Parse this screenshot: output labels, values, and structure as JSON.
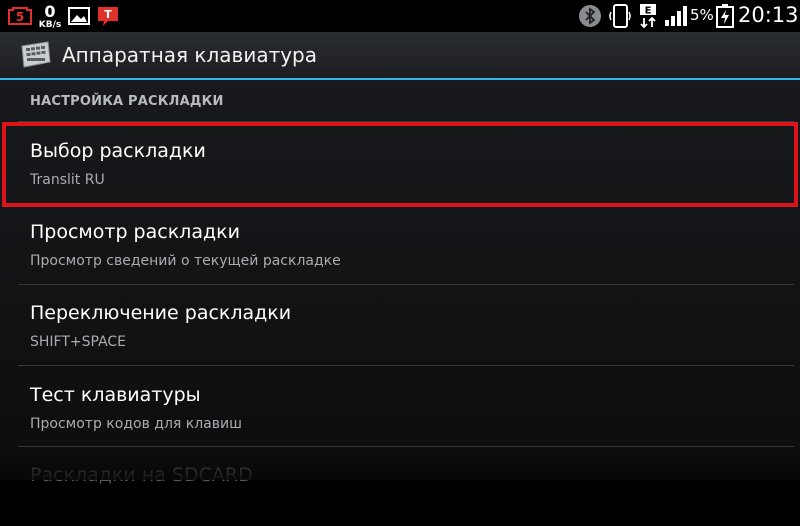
{
  "status_bar": {
    "notification_5": "5",
    "net_speed_value": "0",
    "net_speed_unit": "KB/s",
    "t_badge": "T",
    "network_type": "E",
    "battery_percent": "5%",
    "time": "20:13",
    "icons": [
      "notification-5-icon",
      "gallery-icon",
      "t-notification-icon",
      "bluetooth-icon",
      "phone-icon",
      "network-e-icon",
      "signal-icon",
      "battery-charging-icon"
    ]
  },
  "action_bar": {
    "icon": "keyboard-icon",
    "title": "Аппаратная клавиатура",
    "accent_color": "#33b5e5"
  },
  "section": {
    "header": "НАСТРОЙКА РАСКЛАДКИ"
  },
  "items": [
    {
      "title": "Выбор раскладки",
      "summary": "Translit RU",
      "highlighted": true
    },
    {
      "title": "Просмотр раскладки",
      "summary": "Просмотр сведений о текущей раскладке"
    },
    {
      "title": "Переключение раскладки",
      "summary": "SHIFT+SPACE"
    },
    {
      "title": "Тест клавиатуры",
      "summary": "Просмотр кодов для клавиш"
    },
    {
      "title": "Раскладки на SDCARD",
      "summary": ""
    }
  ],
  "colors": {
    "highlight_border": "#d9141b",
    "notification_red": "#e0312b"
  }
}
